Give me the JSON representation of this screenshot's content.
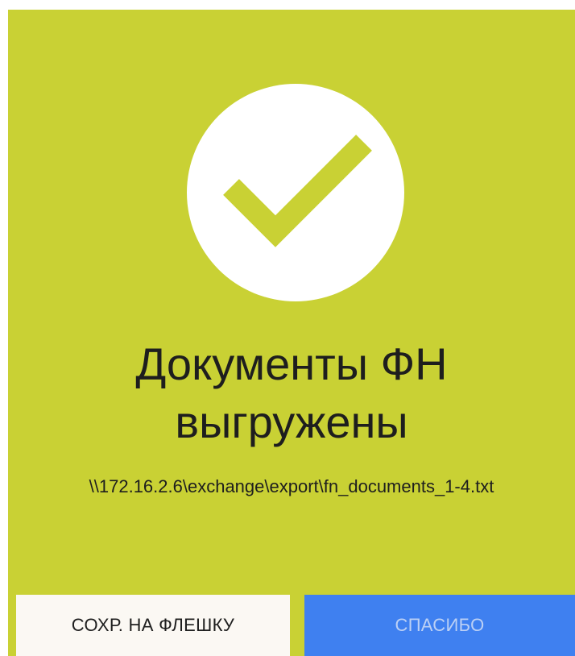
{
  "colors": {
    "background": "#c9d134",
    "check_circle": "#ffffff",
    "check_mark": "#c9d134",
    "text": "#1e1e1e",
    "secondary_button_bg": "#fbf8f3",
    "primary_button_bg": "#3f80f0",
    "primary_button_text": "#bcd0f5"
  },
  "status": {
    "icon": "checkmark-icon",
    "title_line1": "Документы ФН",
    "title_line2": "выгружены",
    "path": "\\\\172.16.2.6\\exchange\\export\\fn_documents_1-4.txt"
  },
  "actions": {
    "save_to_flash_label": "СОХР. НА ФЛЕШКУ",
    "thanks_label": "СПАСИБО"
  }
}
